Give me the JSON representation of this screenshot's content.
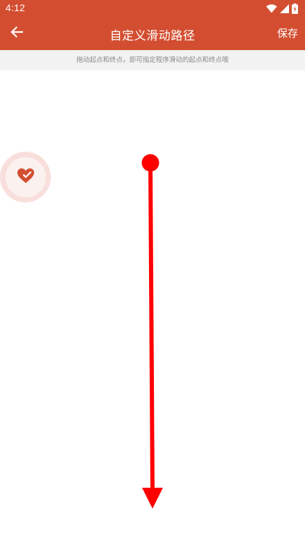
{
  "status_bar": {
    "time": "4:12",
    "icons": [
      "wifi-icon",
      "signal-icon",
      "battery-icon"
    ]
  },
  "app_bar": {
    "back_icon": "arrow-left-icon",
    "title": "自定义滑动路径",
    "save_label": "保存"
  },
  "hint": {
    "text": "拖动起点和终点，即可指定程序滑动的起点和终点哦"
  },
  "floating_button": {
    "icon": "heart-check-icon"
  },
  "swipe": {
    "start_handle": "start-point",
    "end_handle": "end-arrow",
    "color": "#ff0000"
  },
  "colors": {
    "primary": "#d34e31",
    "hint_background": "#f2f2f2",
    "hint_text": "#8a8a8a",
    "path": "#ff0000"
  }
}
